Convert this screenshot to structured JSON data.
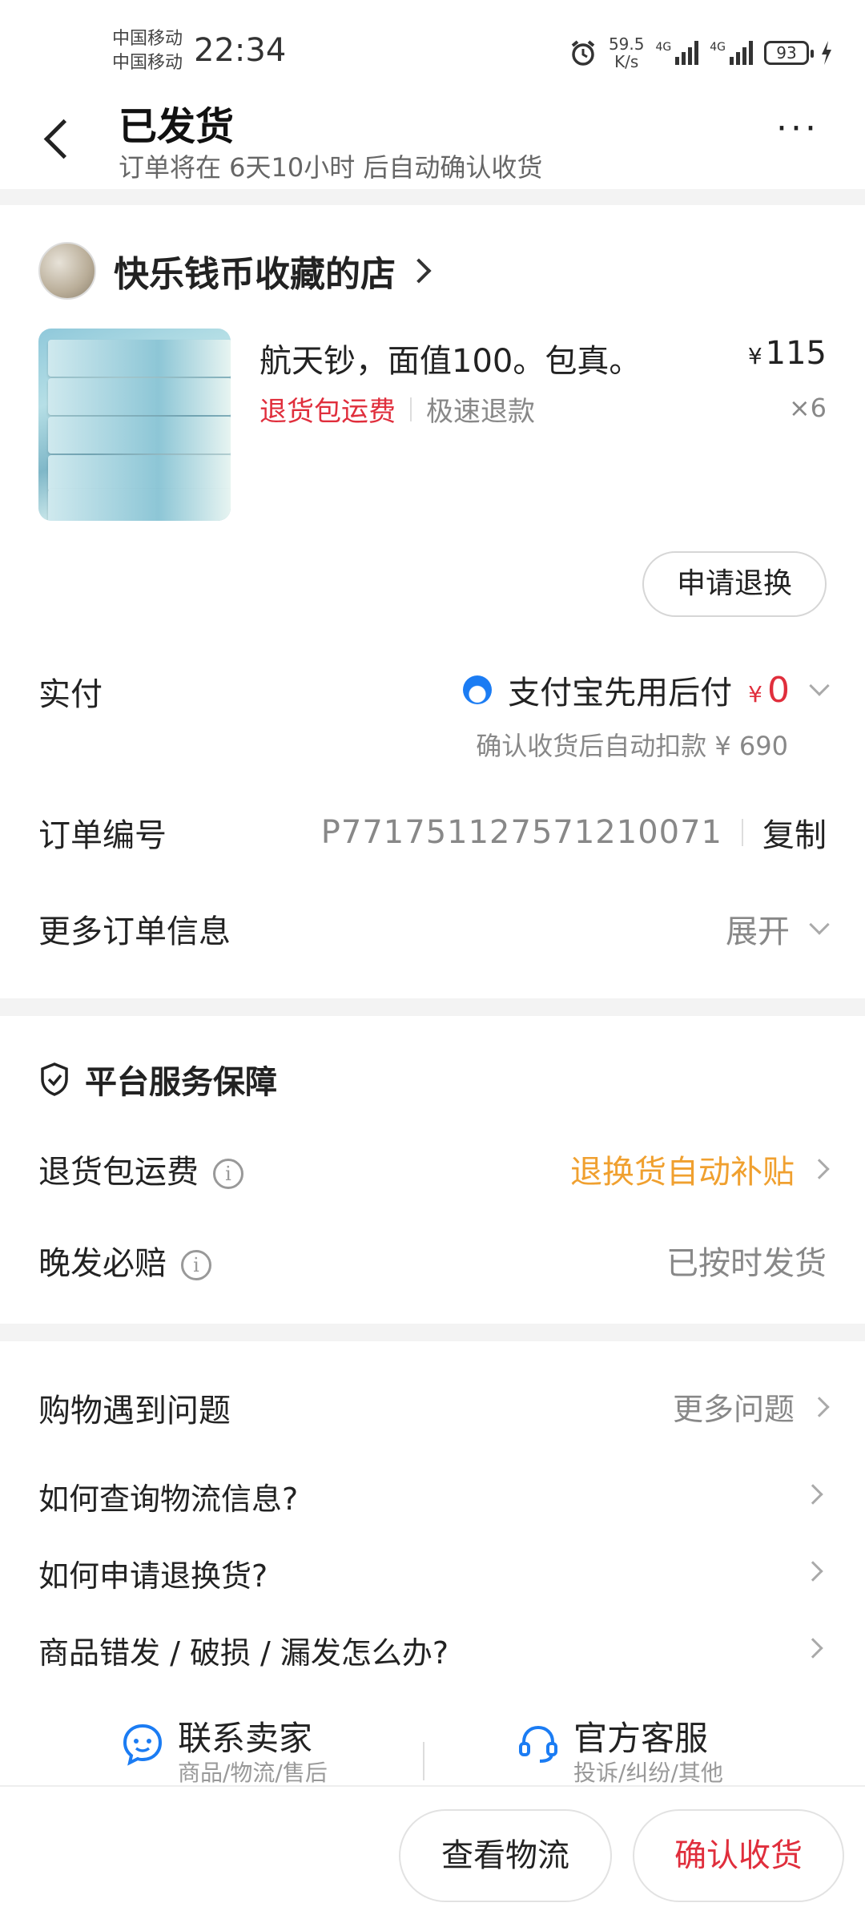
{
  "status_bar": {
    "carrier_1": "中国移动",
    "carrier_2": "中国移动",
    "time": "22:34",
    "net_speed_value": "59.5",
    "net_speed_unit": "K/s",
    "sig1_tag": "4G",
    "sig2_tag": "4G",
    "battery": "93"
  },
  "header": {
    "title": "已发货",
    "subtitle": "订单将在 6天10小时 后自动确认收货",
    "more_label": "···"
  },
  "order": {
    "shop_name": "快乐钱币收藏的店",
    "product_title": "航天钞，面值100。包真。",
    "currency": "¥",
    "price": "115",
    "quantity": "×6",
    "tag_return_shipping": "退货包运费",
    "tag_fast_refund": "极速退款",
    "refund_button": "申请退换",
    "paid_label": "实付",
    "pay_method": "支付宝先用后付",
    "paid_amount": "0",
    "pay_note": "确认收货后自动扣款 ¥ 690",
    "order_no_label": "订单编号",
    "order_no": "P771751127571210071",
    "copy_label": "复制",
    "more_info_label": "更多订单信息",
    "expand_label": "展开"
  },
  "service": {
    "title": "平台服务保障",
    "items": [
      {
        "label": "退货包运费",
        "value": "退换货自动补贴"
      },
      {
        "label": "晚发必赔",
        "value": "已按时发货"
      }
    ]
  },
  "help": {
    "title": "购物遇到问题",
    "more_label": "更多问题",
    "questions": [
      "如何查询物流信息?",
      "如何申请退换货?",
      "商品错发 / 破损 / 漏发怎么办?"
    ],
    "contact_seller": {
      "title": "联系卖家",
      "sub": "商品/物流/售后"
    },
    "official_service": {
      "title": "官方客服",
      "sub": "投诉/纠纷/其他"
    }
  },
  "bottom_bar": {
    "logistics_button": "查看物流",
    "confirm_button": "确认收货"
  },
  "colors": {
    "accent_red": "#e02e3c",
    "orange": "#f0a02f",
    "alipay_blue": "#1b7cf3"
  }
}
